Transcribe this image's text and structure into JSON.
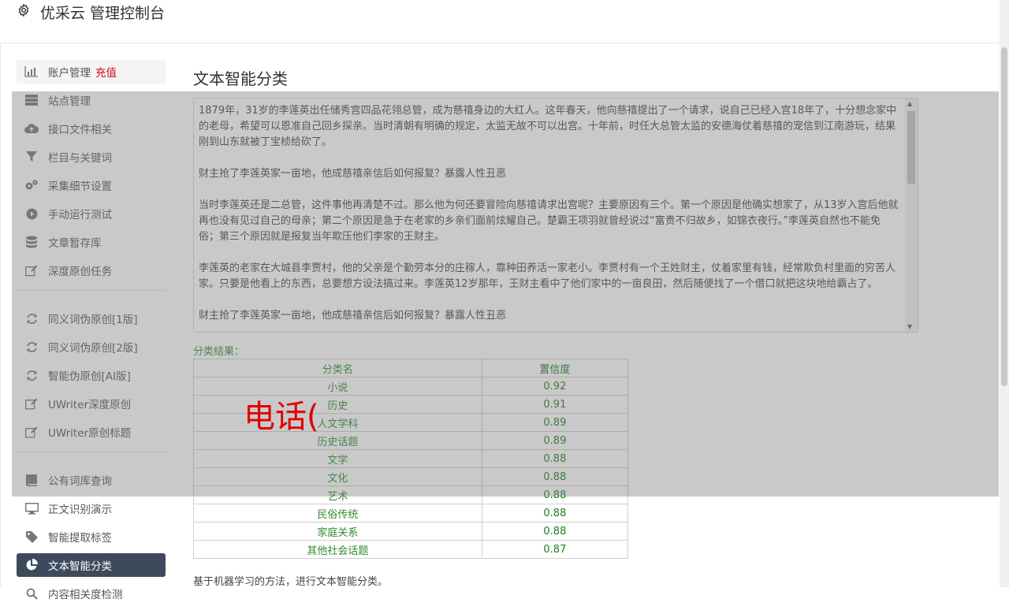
{
  "header": {
    "title": "优采云 管理控制台",
    "logo_icon": "gear-icon"
  },
  "sidebar": {
    "recharge_label": "充值",
    "group1": [
      {
        "label": "账户管理",
        "icon": "bar-chart-icon"
      },
      {
        "label": "站点管理",
        "icon": "server-icon"
      },
      {
        "label": "接口文件相关",
        "icon": "cloud-upload-icon"
      },
      {
        "label": "栏目与关键词",
        "icon": "filter-icon"
      },
      {
        "label": "采集细节设置",
        "icon": "gears-icon"
      },
      {
        "label": "手动运行测试",
        "icon": "play-circle-icon"
      },
      {
        "label": "文章暂存库",
        "icon": "database-icon"
      },
      {
        "label": "深度原创任务",
        "icon": "edit-icon"
      }
    ],
    "group2": [
      {
        "label": "同义词伪原创[1版]",
        "icon": "refresh-icon"
      },
      {
        "label": "同义词伪原创[2版]",
        "icon": "refresh-icon"
      },
      {
        "label": "智能伪原创[AI版]",
        "icon": "refresh-icon"
      },
      {
        "label": "UWriter深度原创",
        "icon": "edit-icon"
      },
      {
        "label": "UWriter原创标题",
        "icon": "edit-icon"
      }
    ],
    "group3": [
      {
        "label": "公有词库查询",
        "icon": "book-icon"
      },
      {
        "label": "正文识别演示",
        "icon": "monitor-icon"
      },
      {
        "label": "智能提取标签",
        "icon": "tag-icon"
      },
      {
        "label": "文本智能分类",
        "icon": "pie-chart-icon"
      },
      {
        "label": "内容相关度检测",
        "icon": "search-icon"
      }
    ]
  },
  "main": {
    "title": "文本智能分类",
    "article": {
      "paragraphs": [
        "1879年，31岁的李莲英出任储秀宫四品花翎总管，成为慈禧身边的大红人。这年春天，他向慈禧提出了一个请求，说自己已经入宫18年了，十分想念家中的老母，希望可以恩准自己回乡探亲。当时清朝有明确的规定，太监无故不可以出宫。十年前，时任大总管太监的安德海仗着慈禧的宠信到江南游玩，结果刚到山东就被丁宝桢给砍了。",
        "财主抢了李莲英家一亩地，他成慈禧亲信后如何报复？暴露人性丑恶",
        "当时李莲英还是二总管，这件事他再清楚不过。那么他为何还要冒险向慈禧请求出宫呢？主要原因有三个。第一个原因是他确实想家了，从13岁入宫后他就再也没有见过自己的母亲；第二个原因是急于在老家的乡亲们面前炫耀自己。楚霸王项羽就曾经说过“富贵不归故乡，如锦衣夜行。”李莲英自然也不能免俗；第三个原因就是报复当年欺压他们李家的王财主。",
        "李莲英的老家在大城县李贾村，他的父亲是个勤劳本分的庄稼人，靠种田养活一家老小。李贾村有一个王姓财主，仗着家里有钱，经常欺负村里面的穷苦人家。只要是他看上的东西，总要想方设法搞过来。李莲英12岁那年，王财主看中了他们家中的一亩良田，然后随便找了一个借口就把这块地给霸占了。",
        "财主抢了李莲英家一亩地，他成慈禧亲信后如何报复？暴露人性丑恶"
      ]
    },
    "result_label": "分类结果：",
    "table": {
      "headers": [
        "分类名",
        "置信度"
      ],
      "rows": [
        [
          "小说",
          "0.92"
        ],
        [
          "历史",
          "0.91"
        ],
        [
          "人文学科",
          "0.89"
        ],
        [
          "历史话题",
          "0.89"
        ],
        [
          "文学",
          "0.88"
        ],
        [
          "文化",
          "0.88"
        ],
        [
          "艺术",
          "0.88"
        ],
        [
          "民俗传统",
          "0.88"
        ],
        [
          "家庭关系",
          "0.88"
        ],
        [
          "其他社会话题",
          "0.87"
        ]
      ]
    },
    "footnote": "基于机器学习的方法，进行文本智能分类。"
  },
  "overlay": {
    "text": "电话("
  }
}
